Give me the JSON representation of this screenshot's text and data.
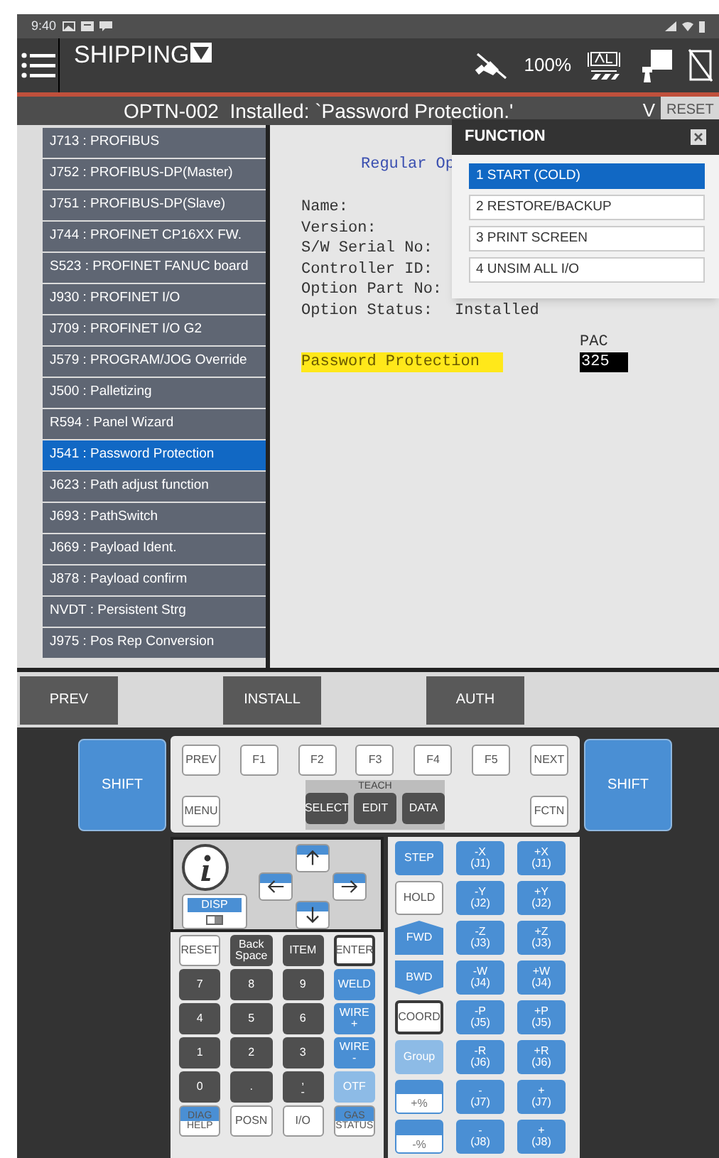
{
  "status_bar": {
    "time": "9:40"
  },
  "header": {
    "title": "SHIPPING",
    "speed": "100%"
  },
  "message_bar": {
    "text": "OPTN-002  Installed: `Password Protection.'",
    "toggle": "V",
    "reset_button": "RESET"
  },
  "options": [
    {
      "label": "J713 : PROFIBUS",
      "selected": false
    },
    {
      "label": "J752 : PROFIBUS-DP(Master)",
      "selected": false
    },
    {
      "label": "J751 : PROFIBUS-DP(Slave)",
      "selected": false
    },
    {
      "label": "J744 : PROFINET CP16XX FW.",
      "selected": false
    },
    {
      "label": "S523 : PROFINET FANUC board",
      "selected": false
    },
    {
      "label": "J930 : PROFINET I/O",
      "selected": false
    },
    {
      "label": "J709 : PROFINET I/O G2",
      "selected": false
    },
    {
      "label": "J579 : PROGRAM/JOG Override",
      "selected": false
    },
    {
      "label": "J500 : Palletizing",
      "selected": false
    },
    {
      "label": "R594 : Panel Wizard",
      "selected": false
    },
    {
      "label": "J541 : Password Protection",
      "selected": true
    },
    {
      "label": "J623 : Path adjust function",
      "selected": false
    },
    {
      "label": "J693 : PathSwitch",
      "selected": false
    },
    {
      "label": "J669 : Payload Ident.",
      "selected": false
    },
    {
      "label": "J878 : Payload confirm",
      "selected": false
    },
    {
      "label": "NVDT : Persistent Strg",
      "selected": false
    },
    {
      "label": "J975 : Pos Rep Conversion",
      "selected": false
    }
  ],
  "detail": {
    "heading": "Regular Op",
    "fields": [
      {
        "label": "Name:"
      },
      {
        "label": "Version:"
      },
      {
        "label": "S/W Serial No:"
      },
      {
        "label": "Controller ID:"
      },
      {
        "label": "Option Part No:"
      },
      {
        "label": "Option Status:",
        "value": "Installed"
      }
    ],
    "option_name": "Password Protection",
    "pac_label": "PAC",
    "pac_value": "325"
  },
  "function_menu": {
    "title": "FUNCTION",
    "items": [
      {
        "label": "1 START (COLD)",
        "selected": true
      },
      {
        "label": "2 RESTORE/BACKUP",
        "selected": false
      },
      {
        "label": "3 PRINT SCREEN",
        "selected": false
      },
      {
        "label": "4 UNSIM ALL I/O",
        "selected": false
      }
    ]
  },
  "softkeys": [
    "PREV",
    "INSTALL",
    "AUTH"
  ],
  "keypad": {
    "shift_keys": [
      "SHIFT",
      "SHIFT"
    ],
    "function_keys": [
      "PREV",
      "F1",
      "F2",
      "F3",
      "F4",
      "F5",
      "NEXT"
    ],
    "menu_key": "MENU",
    "teach": {
      "label": "TEACH",
      "keys": [
        "SELECT",
        "EDIT",
        "DATA"
      ]
    },
    "fctn_key": "FCTN",
    "disp_key": "DISP",
    "numpad": [
      {
        "label": "RESET",
        "kind": "white"
      },
      {
        "label": "Back\nSpace",
        "kind": "dark"
      },
      {
        "label": "ITEM",
        "kind": "dark"
      },
      {
        "label": "ENTER",
        "kind": "outlined"
      },
      {
        "label": "7",
        "kind": "dark"
      },
      {
        "label": "8",
        "kind": "dark"
      },
      {
        "label": "9",
        "kind": "dark"
      },
      {
        "label": "WELD",
        "kind": "blue"
      },
      {
        "label": "4",
        "kind": "dark"
      },
      {
        "label": "5",
        "kind": "dark"
      },
      {
        "label": "6",
        "kind": "dark"
      },
      {
        "label": "WIRE\n+",
        "kind": "blue"
      },
      {
        "label": "1",
        "kind": "dark"
      },
      {
        "label": "2",
        "kind": "dark"
      },
      {
        "label": "3",
        "kind": "dark"
      },
      {
        "label": "WIRE\n-",
        "kind": "blue"
      },
      {
        "label": "0",
        "kind": "dark"
      },
      {
        "label": ".",
        "kind": "dark"
      },
      {
        "label": ",\n-",
        "kind": "dark"
      },
      {
        "label": "OTF",
        "kind": "lightblue"
      },
      {
        "label": "DIAG",
        "sub": "HELP",
        "kind": "split"
      },
      {
        "label": "POSN",
        "kind": "white"
      },
      {
        "label": "I/O",
        "kind": "white"
      },
      {
        "label": "GAS",
        "sub": "STATUS",
        "kind": "split"
      }
    ],
    "motion_keys": [
      {
        "label": "STEP",
        "kind": "blue"
      },
      {
        "label": "HOLD",
        "kind": "white"
      },
      {
        "label": "FWD",
        "kind": "hex_up"
      },
      {
        "label": "BWD",
        "kind": "hex_down"
      },
      {
        "label": "COORD",
        "kind": "outlined"
      },
      {
        "label": "Group",
        "kind": "lightblue"
      },
      {
        "label": "+%",
        "kind": "speed_up"
      },
      {
        "label": "-%",
        "kind": "speed_down"
      }
    ],
    "jog_keys": [
      "-X\n(J1)",
      "+X\n(J1)",
      "-Y\n(J2)",
      "+Y\n(J2)",
      "-Z\n(J3)",
      "+Z\n(J3)",
      "-W\n(J4)",
      "+W\n(J4)",
      "-P\n(J5)",
      "+P\n(J5)",
      "-R\n(J6)",
      "+R\n(J6)",
      "-\n(J7)",
      "+\n(J7)",
      "-\n(J8)",
      "+\n(J8)"
    ]
  }
}
